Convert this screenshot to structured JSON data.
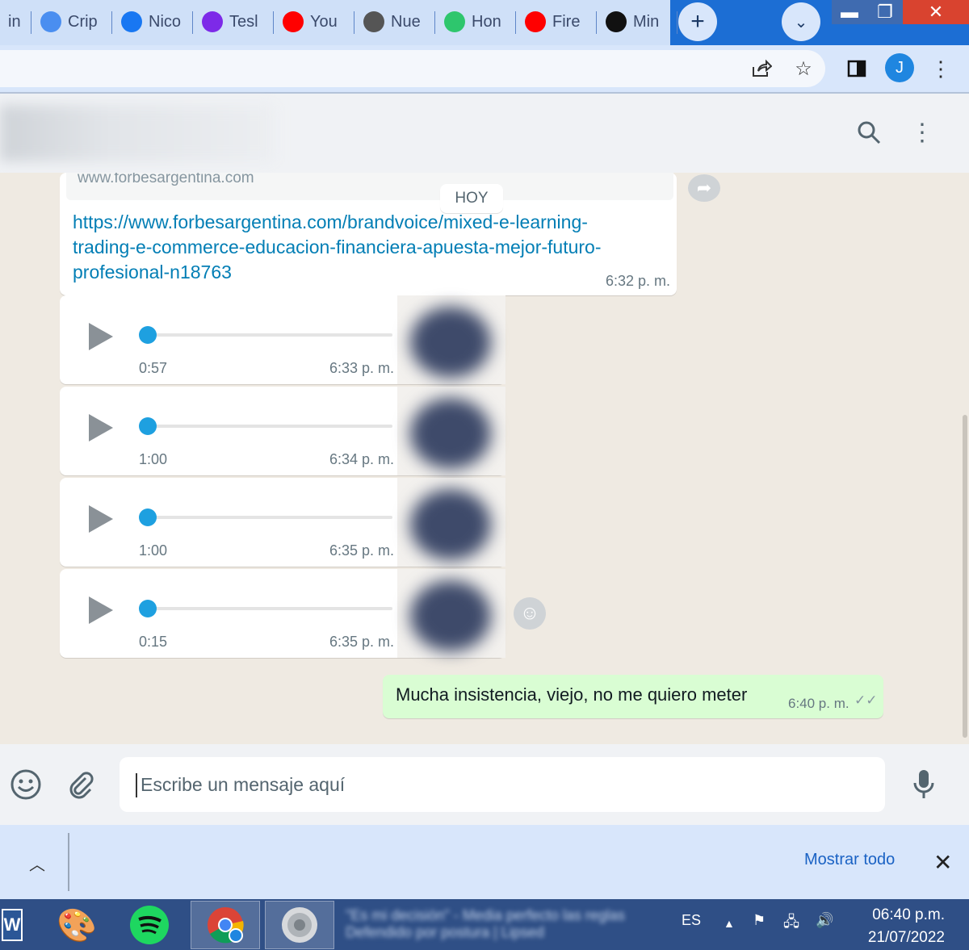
{
  "browser": {
    "tabs": [
      {
        "title": "in",
        "icon": "linkedin-icon",
        "color": "#cfe0f8"
      },
      {
        "title": "Crip",
        "icon": "crypto-icon",
        "color": "#4a8ef0"
      },
      {
        "title": "Nico",
        "icon": "facebook-icon",
        "color": "#1877f2"
      },
      {
        "title": "Tesl",
        "icon": "canva-icon",
        "color": "#7d2ae8"
      },
      {
        "title": "You",
        "icon": "youtube-icon",
        "color": "#ff0000"
      },
      {
        "title": "Nue",
        "icon": "chrome-icon",
        "color": "#555555"
      },
      {
        "title": "Hon",
        "icon": "pixabay-icon",
        "color": "#2ec66d"
      },
      {
        "title": "Fire",
        "icon": "youtube-icon",
        "color": "#ff0000"
      },
      {
        "title": "Min",
        "icon": "forbes-icon",
        "color": "#111111"
      }
    ],
    "new_tab_label": "+",
    "profile_initial": "J"
  },
  "chat": {
    "link_preview_domain": "www.forbesargentina.com",
    "link_message": "https://www.forbesargentina.com/brandvoice/mixed-e-learning-trading-e-commerce-educacion-financiera-apuesta-mejor-futuro-profesional-n18763",
    "link_display_lines": [
      "https://www.forbesargentina.com/brandvoice/mixed-e-learning-",
      "trading-e-commerce-educacion-financiera-apuesta-mejor-futuro-",
      "profesional-n18763"
    ],
    "link_time": "6:32 p. m.",
    "day_separator": "HOY",
    "audio_messages": [
      {
        "duration": "0:57",
        "time": "6:33 p. m.",
        "progress": 0
      },
      {
        "duration": "1:00",
        "time": "6:34 p. m.",
        "progress": 0
      },
      {
        "duration": "1:00",
        "time": "6:35 p. m.",
        "progress": 0
      },
      {
        "duration": "0:15",
        "time": "6:35 p. m.",
        "progress": 0
      }
    ],
    "outgoing_message": {
      "text": "Mucha insistencia, viejo, no me quiero meter",
      "time": "6:40 p. m.",
      "status": "read-ticks"
    }
  },
  "compose": {
    "placeholder": "Escribe un mensaje aquí"
  },
  "downloads": {
    "show_all_label": "Mostrar todo"
  },
  "taskbar": {
    "apps": [
      "word-icon",
      "paint-icon",
      "spotify-icon",
      "chrome-icon",
      "speaker-icon"
    ],
    "language": "ES",
    "time": "06:40 p.m.",
    "date": "21/07/2022"
  }
}
